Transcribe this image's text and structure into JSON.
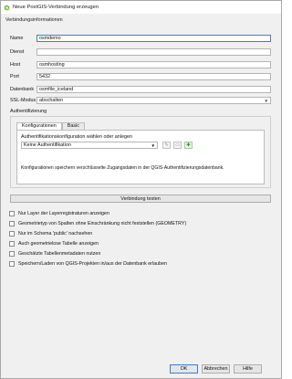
{
  "window": {
    "title": "Neue PostGIS-Verbindung erzeugen"
  },
  "connection": {
    "section_label": "Verbindungsinformationen",
    "fields": [
      {
        "label": "Name",
        "value": "osmdemo"
      },
      {
        "label": "Dienst",
        "value": ""
      },
      {
        "label": "Host",
        "value": "osmhosting"
      },
      {
        "label": "Port",
        "value": "5432"
      },
      {
        "label": "Datenbank",
        "value": "osmfile_iceland"
      }
    ],
    "ssl": {
      "label": "SSL-Modus",
      "value": "abschalten"
    }
  },
  "auth": {
    "label": "Authentifizierung",
    "tabs": [
      "Konfigurationen",
      "Basic"
    ],
    "caption": "Authentifikationskonfiguration wählen oder anlegen",
    "selected": "Keine Authentifikation",
    "note": "Konfigurationen speichern verschlüsselte Zugangsdaten in der QGIS-Authentifizierungsdatenbank."
  },
  "test_button": "Verbindung testen",
  "options": [
    "Nur Layer der Layerregistraturen anzeigen",
    "Geometrietyp von Spalten ohne Einschränkung nicht feststellen (GEOMETRY)",
    "Nur im Schema 'public' nachsehen",
    "Auch geometrielose Tabelle anzeigen",
    "Geschätzte Tabellenmetadaten nutzen",
    "Speichern/Laden von QGIS-Projekten in/aus der Datenbank erlauben"
  ],
  "buttons": {
    "ok": "OK",
    "cancel": "Abbrechen",
    "help": "Hilfe"
  },
  "colors": {
    "focus": "#3c7fd0",
    "add_icon": "#2f8f2f",
    "qgis_green": "#6db33f"
  }
}
